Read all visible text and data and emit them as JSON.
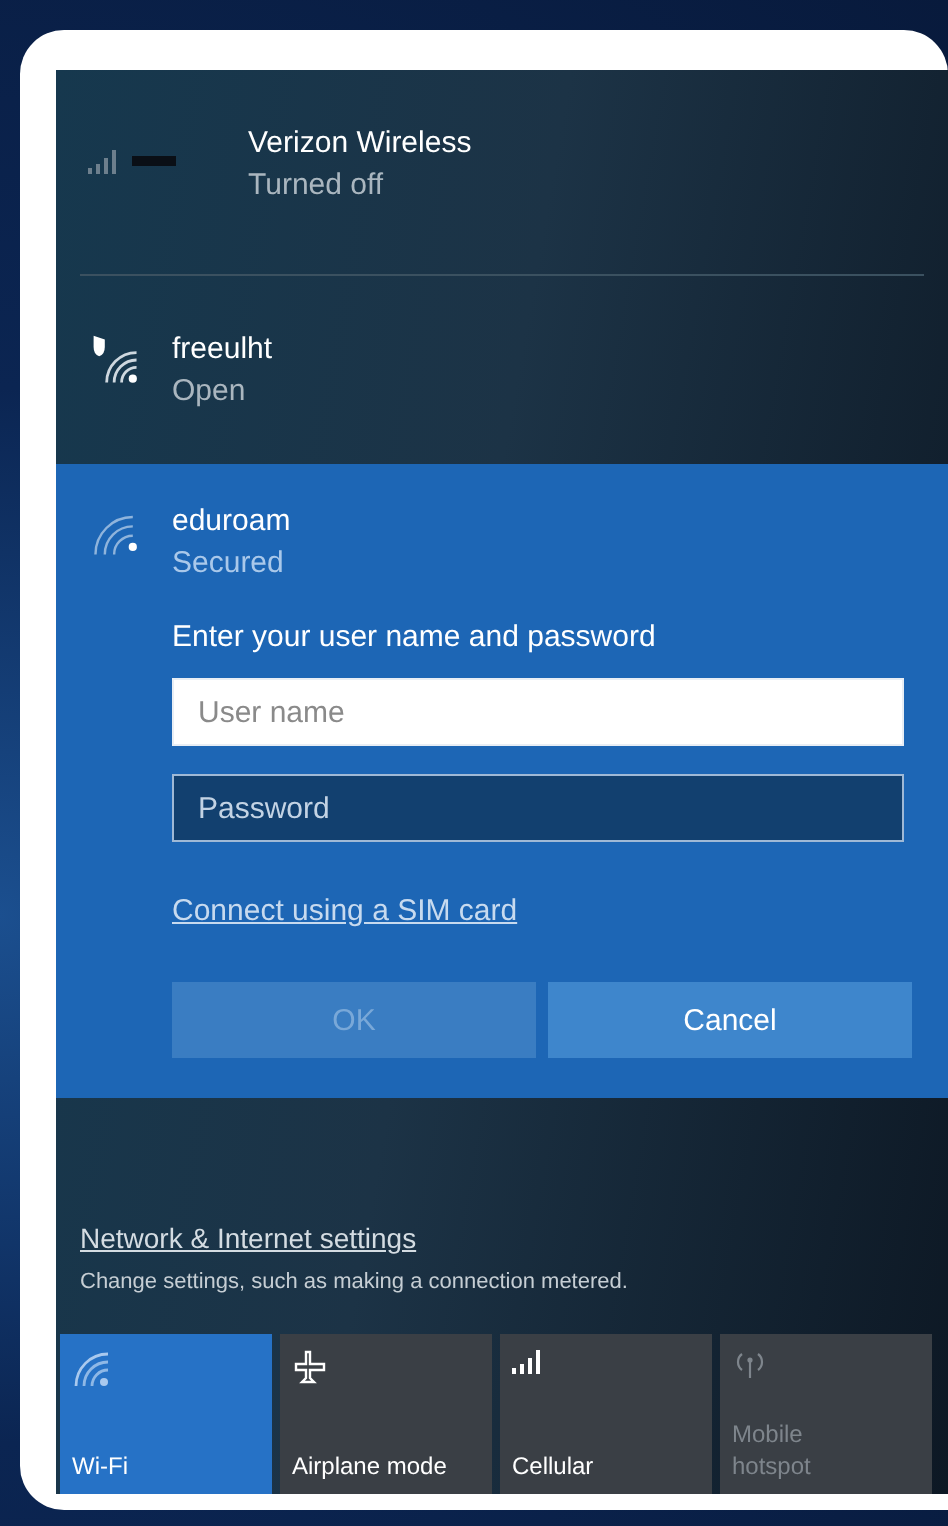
{
  "networks": [
    {
      "kind": "cellular",
      "name": "Verizon Wireless",
      "status": "Turned off",
      "selected": false
    },
    {
      "kind": "wifi-open",
      "name": "freeulht",
      "status": "Open",
      "selected": false
    },
    {
      "kind": "wifi",
      "name": "eduroam",
      "status": "Secured",
      "selected": true
    }
  ],
  "login": {
    "prompt": "Enter your user name and password",
    "username": {
      "placeholder": "User name"
    },
    "password": {
      "placeholder": "Password"
    },
    "sim_link": "Connect using a SIM card",
    "buttons": [
      {
        "label": "OK",
        "disabled": true
      },
      {
        "label": "Cancel",
        "disabled": false
      }
    ]
  },
  "settings": {
    "link": "Network & Internet settings",
    "description": "Change settings, such as making a connection metered."
  },
  "tiles": [
    {
      "kind": "wifi",
      "label": "Wi-Fi",
      "on": true,
      "disabled": false
    },
    {
      "kind": "airplane",
      "label": "Airplane mode",
      "on": false,
      "disabled": false
    },
    {
      "kind": "cellular",
      "label": "Cellular",
      "on": false,
      "disabled": false
    },
    {
      "kind": "hotspot",
      "label": "Mobile hotspot",
      "on": false,
      "disabled": true
    }
  ]
}
